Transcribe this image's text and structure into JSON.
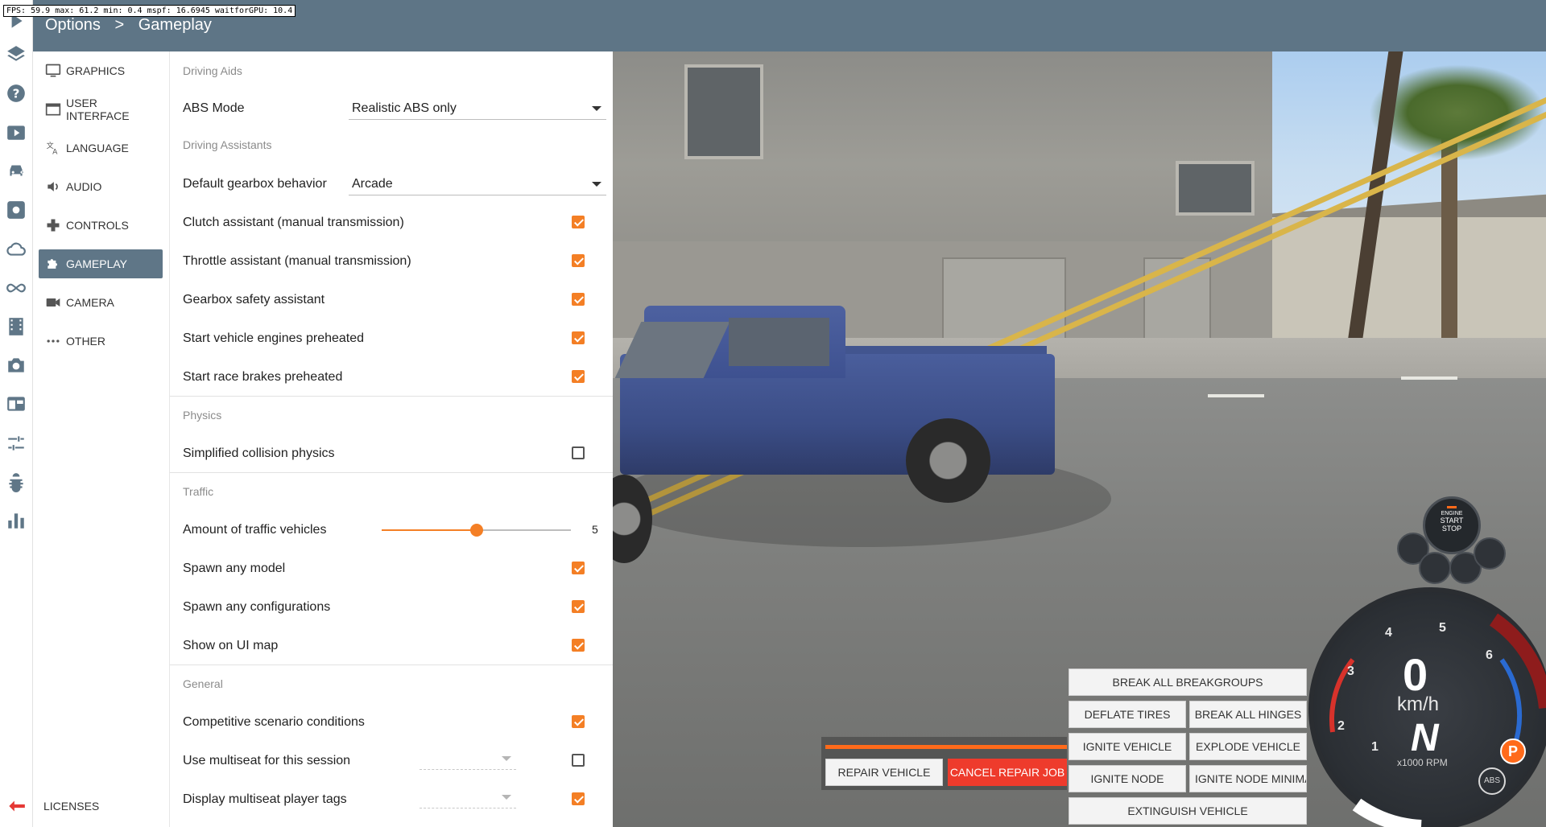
{
  "debug": {
    "fps_text": "FPS: 59.9  max: 61.2  min: 0.4  mspf: 16.6945  waitforGPU: 10.4"
  },
  "breadcrumb": {
    "root": "Options",
    "separator": ">",
    "current": "Gameplay"
  },
  "rail_icons": [
    "play-icon",
    "layers-icon",
    "help-icon",
    "scenario-icon",
    "car-icon",
    "vehicle-config-icon",
    "cloud-icon",
    "infinity-icon",
    "film-icon",
    "camera-icon",
    "ui-apps-icon",
    "tune-icon",
    "bug-icon",
    "chart-icon",
    "back-arrow-icon"
  ],
  "nav": {
    "items": [
      {
        "label": "GRAPHICS",
        "icon": "monitor-icon"
      },
      {
        "label": "USER INTERFACE",
        "icon": "window-icon"
      },
      {
        "label": "LANGUAGE",
        "icon": "translate-icon"
      },
      {
        "label": "AUDIO",
        "icon": "speaker-icon"
      },
      {
        "label": "CONTROLS",
        "icon": "gamepad-icon"
      },
      {
        "label": "GAMEPLAY",
        "icon": "puzzle-icon",
        "active": true
      },
      {
        "label": "CAMERA",
        "icon": "videocam-icon"
      },
      {
        "label": "OTHER",
        "icon": "more-dots-icon"
      }
    ],
    "licenses": "LICENSES"
  },
  "panel": {
    "driving_aids": {
      "heading": "Driving Aids",
      "abs_mode": {
        "label": "ABS Mode",
        "value": "Realistic ABS only"
      }
    },
    "driving_assistants": {
      "heading": "Driving Assistants",
      "gearbox": {
        "label": "Default gearbox behavior",
        "value": "Arcade"
      },
      "clutch": {
        "label": "Clutch assistant (manual transmission)",
        "checked": true
      },
      "throttle": {
        "label": "Throttle assistant (manual transmission)",
        "checked": true
      },
      "gearbox_safety": {
        "label": "Gearbox safety assistant",
        "checked": true
      },
      "engines_preheated": {
        "label": "Start vehicle engines preheated",
        "checked": true
      },
      "brakes_preheated": {
        "label": "Start race brakes preheated",
        "checked": true
      }
    },
    "physics": {
      "heading": "Physics",
      "simplified": {
        "label": "Simplified collision physics",
        "checked": false
      }
    },
    "traffic": {
      "heading": "Traffic",
      "amount": {
        "label": "Amount of traffic vehicles",
        "value": "5",
        "min": 0,
        "max": 10
      },
      "any_model": {
        "label": "Spawn any model",
        "checked": true
      },
      "any_config": {
        "label": "Spawn any configurations",
        "checked": true
      },
      "ui_map": {
        "label": "Show on UI map",
        "checked": true
      }
    },
    "general": {
      "heading": "General",
      "competitive": {
        "label": "Competitive scenario conditions",
        "checked": true
      },
      "multiseat": {
        "label": "Use multiseat for this session",
        "checked": false
      },
      "player_tags": {
        "label": "Display multiseat player tags",
        "checked": true
      }
    }
  },
  "repair": {
    "repair_label": "REPAIR VEHICLE",
    "cancel_label": "CANCEL REPAIR JOB",
    "progress": 1.0
  },
  "damage_buttons": {
    "break_groups": "BREAK ALL BREAKGROUPS",
    "deflate": "DEFLATE TIRES",
    "break_hinges": "BREAK ALL HINGES",
    "ignite": "IGNITE VEHICLE",
    "explode": "EXPLODE VEHICLE",
    "ignite_node": "IGNITE NODE",
    "ignite_node_min": "IGNITE NODE MINIMA",
    "extinguish": "EXTINGUISH VEHICLE"
  },
  "dashboard": {
    "speed": "0",
    "unit": "km/h",
    "gear": "N",
    "rpm_label": "x1000 RPM",
    "rpm_ticks": [
      "1",
      "2",
      "3",
      "4",
      "5",
      "6"
    ],
    "engine_text": [
      "ENGINE",
      "START",
      "STOP"
    ],
    "park": "P",
    "abs": "ABS",
    "colors": {
      "accent": "#ff6a1a",
      "redline": "#d7322b",
      "blue": "#2a6ad1"
    }
  },
  "colors": {
    "accent": "#f47f25",
    "header": "#5e7586",
    "nav_active": "#5f7687"
  }
}
